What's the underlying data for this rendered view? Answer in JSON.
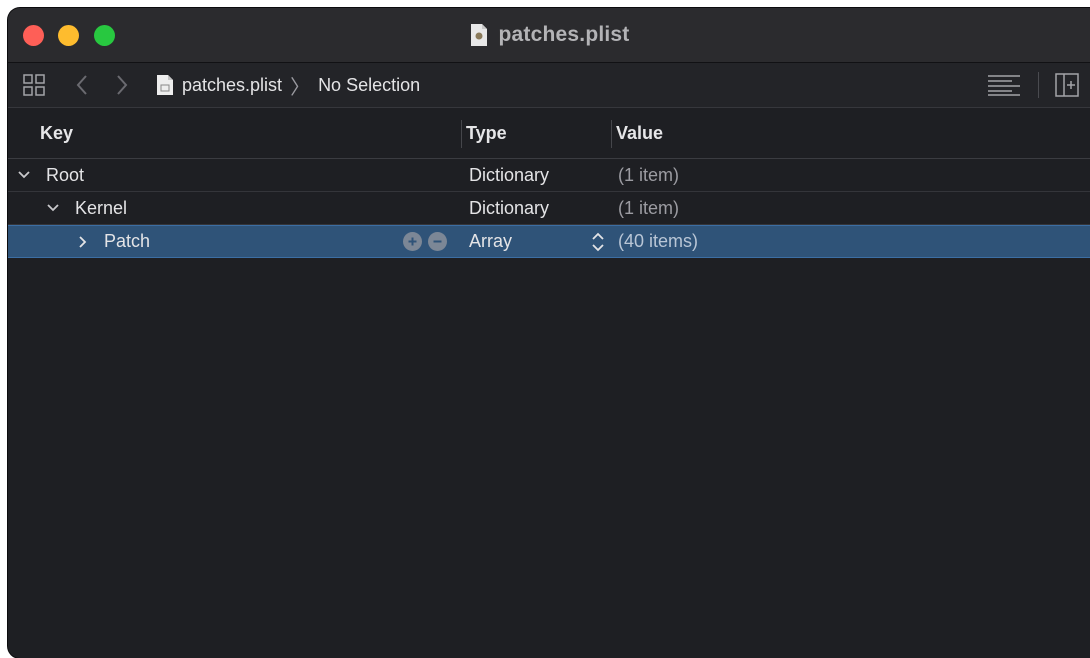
{
  "window": {
    "title": "patches.plist"
  },
  "toolbar": {
    "breadcrumb": [
      {
        "label": "patches.plist"
      },
      {
        "label": "No Selection"
      }
    ]
  },
  "columns": {
    "key": "Key",
    "type": "Type",
    "value": "Value"
  },
  "rows": [
    {
      "key": "Root",
      "type": "Dictionary",
      "value": "(1 item)",
      "expanded": true,
      "selected": false
    },
    {
      "key": "Kernel",
      "type": "Dictionary",
      "value": "(1 item)",
      "expanded": true,
      "selected": false
    },
    {
      "key": "Patch",
      "type": "Array",
      "value": "(40 items)",
      "expanded": false,
      "selected": true
    }
  ],
  "colors": {
    "window_bg": "#1e1f23",
    "selection": "#2f5378",
    "close": "#fe5f57",
    "minimize": "#febc2e",
    "zoom": "#28c840"
  }
}
